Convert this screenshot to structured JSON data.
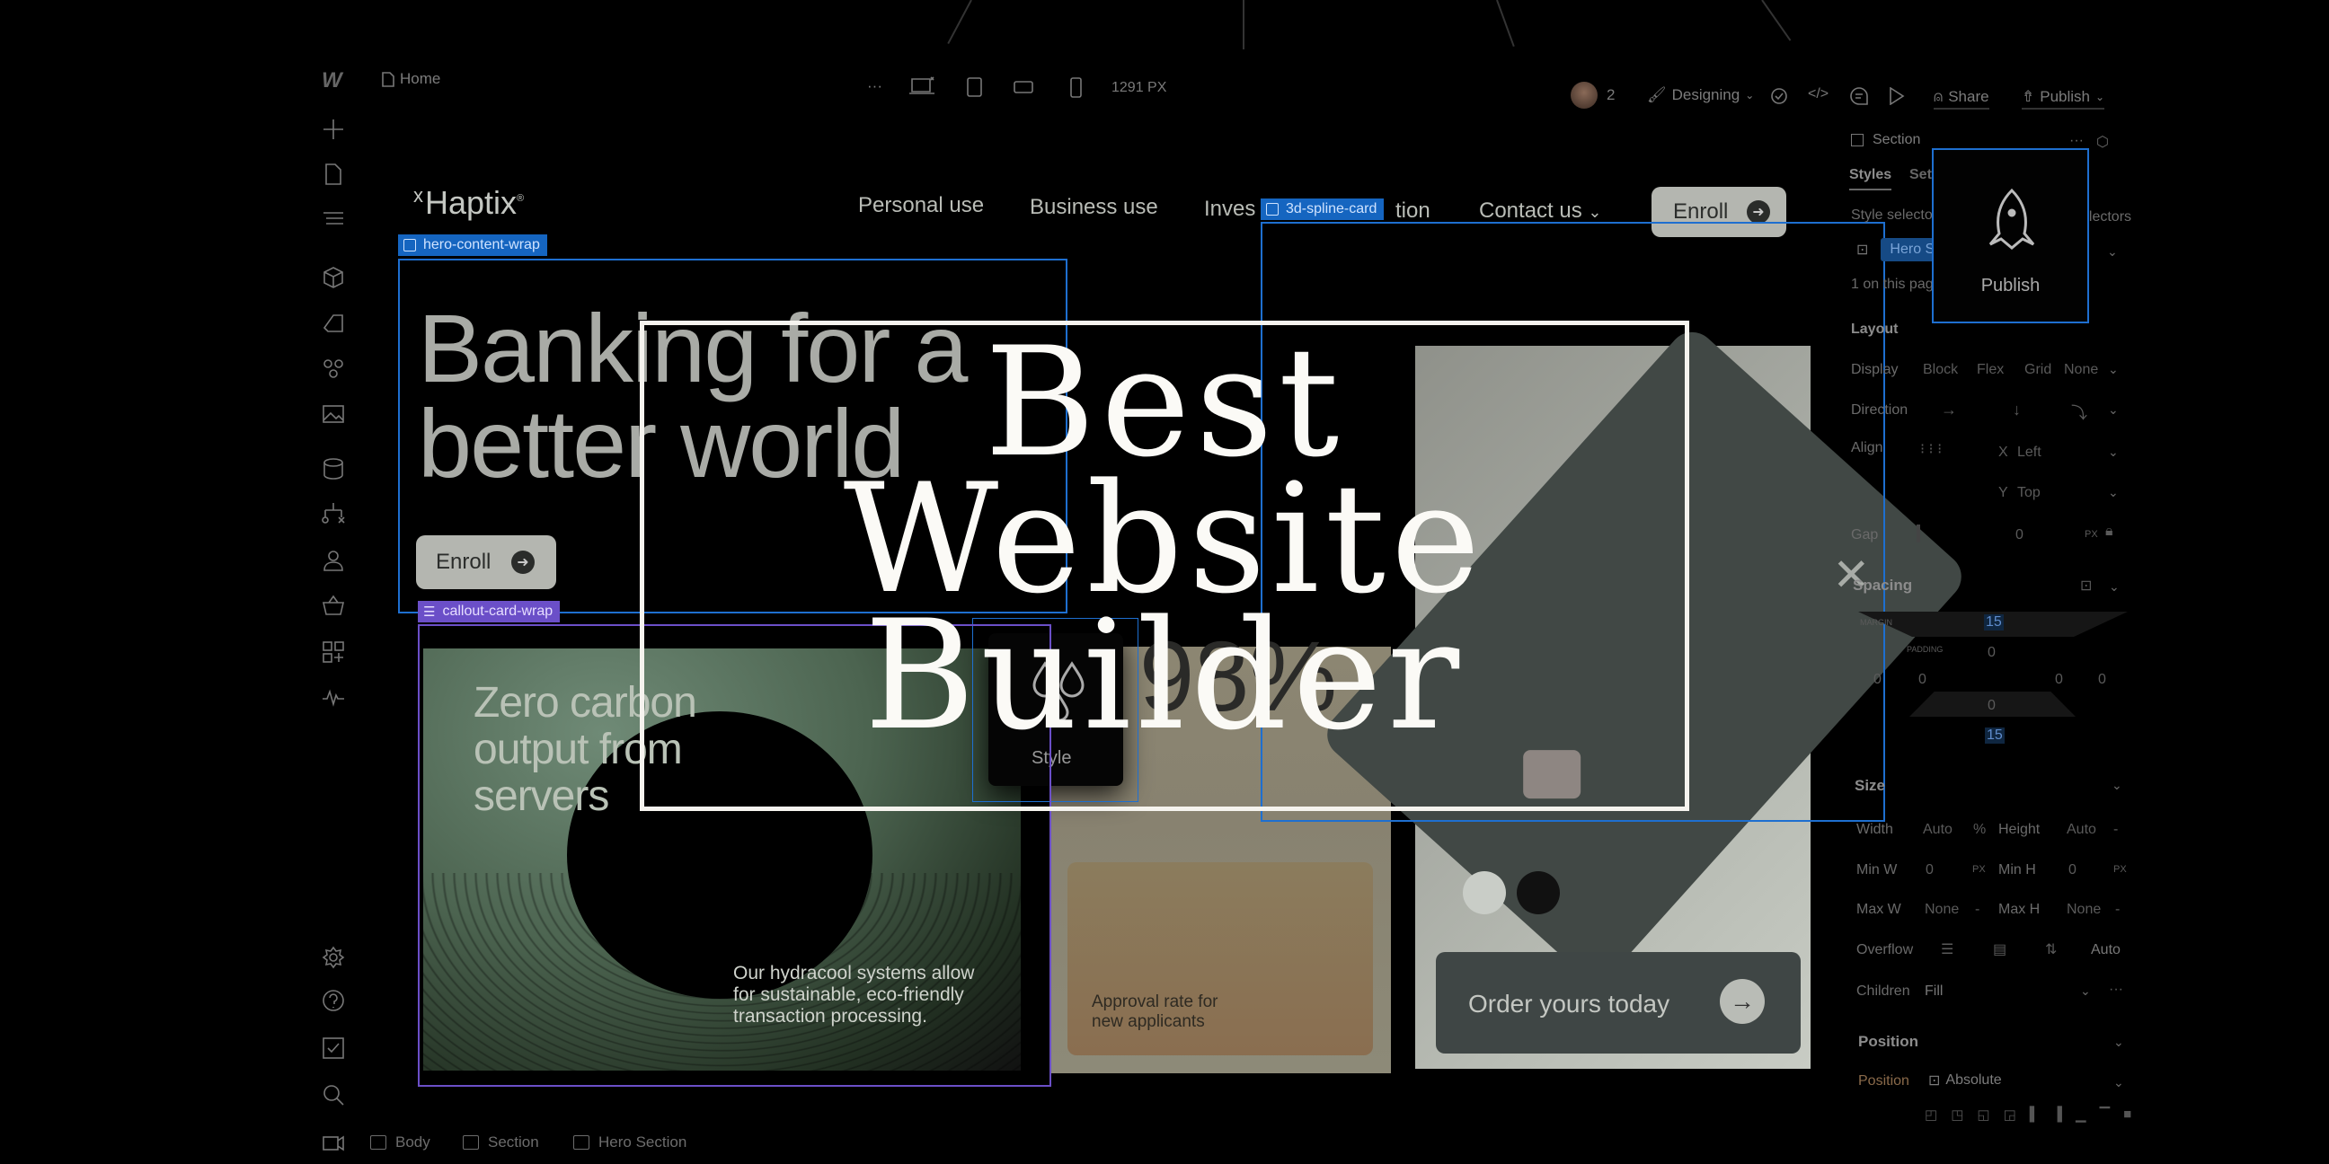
{
  "topbar": {
    "logo": "webflow-logo",
    "page_name": "Home",
    "more_label": "···",
    "viewport_width": "1291 PX",
    "collaborator_count": "2",
    "mode_label": "Designing",
    "share_label": "Share",
    "publish_label": "Publish"
  },
  "left_sidebar": {
    "top_icons": [
      "add-icon",
      "pages-icon",
      "navigator-icon",
      "components-icon",
      "variables-icon",
      "styles-icon",
      "assets-icon",
      "cms-icon",
      "logic-icon",
      "users-icon",
      "ecommerce-icon",
      "apps-icon",
      "audit-icon"
    ],
    "bottom_icons": [
      "settings-icon",
      "help-icon",
      "tasks-icon",
      "search-icon",
      "video-icon"
    ]
  },
  "site": {
    "brand": "Haptix",
    "brand_mark": "x",
    "nav": [
      "Personal use",
      "Business use",
      "Investigation",
      "Contact us"
    ],
    "nav_visible": [
      "Personal use",
      "Business use",
      "Inves",
      "tion",
      "Contact us"
    ],
    "nav_enroll": "Enroll",
    "hero_title_line1": "Banking for a",
    "hero_title_line2": "better world",
    "hero_enroll": "Enroll",
    "green_card_title": [
      "Zero carbon",
      "output from",
      "servers"
    ],
    "green_card_desc": [
      "Our hydracool systems allow",
      "for sustainable, eco-friendly",
      "transaction processing."
    ],
    "tan_card_stat": "98%",
    "tan_card_desc": [
      "Approval rate for",
      "new applicants"
    ],
    "style_popup_label": "Style",
    "order_button": "Order yours today",
    "color_swatches": [
      "#c9cdc7",
      "#111111"
    ]
  },
  "selection_labels": {
    "hero": "hero-content-wrap",
    "callout": "callout-card-wrap",
    "spline": "3d-spline-card"
  },
  "overlay": {
    "line1": "Best",
    "line2": "Website",
    "line3": "Builder"
  },
  "right_panel": {
    "element_type": "Section",
    "tabs": [
      "Styles",
      "Settings"
    ],
    "tab_visible": [
      "Styles",
      "Setti"
    ],
    "style_selector_label": "Style selector",
    "selectors_label": "selectors",
    "selected_class": "Hero Section",
    "selected_class_visible": "Hero Se",
    "usage_text": "1 on this page",
    "publish_popup": "Publish",
    "layout": {
      "heading": "Layout",
      "display_label": "Display",
      "display_options": [
        "Block",
        "Flex",
        "Grid",
        "None"
      ],
      "direction_label": "Direction",
      "align_label": "Align",
      "align_x": "Left",
      "align_y": "Top",
      "gap_label": "Gap",
      "gap_value": "0",
      "gap_unit": "PX"
    },
    "spacing": {
      "heading": "Spacing",
      "margin_label": "MARGIN",
      "padding_label": "PADDING",
      "margin_top": "15",
      "margin_bottom": "15",
      "margin_left": "0",
      "margin_right": "0",
      "padding_top": "0",
      "padding_bottom": "0",
      "padding_left": "0",
      "padding_right": "0"
    },
    "size": {
      "heading": "Size",
      "width_label": "Width",
      "width_value": "Auto",
      "width_unit": "%",
      "height_label": "Height",
      "height_value": "Auto",
      "height_unit": "-",
      "minw_label": "Min W",
      "minw_value": "0",
      "minw_unit": "PX",
      "minh_label": "Min H",
      "minh_value": "0",
      "minh_unit": "PX",
      "maxw_label": "Max W",
      "maxw_value": "None",
      "maxw_unit": "-",
      "maxh_label": "Max H",
      "maxh_value": "None",
      "maxh_unit": "-",
      "overflow_label": "Overflow",
      "overflow_value": "Auto",
      "children_label": "Children",
      "children_value": "Fill"
    },
    "position": {
      "heading": "Position",
      "label": "Position",
      "value": "Absolute"
    }
  },
  "breadcrumb": [
    "Body",
    "Section",
    "Hero Section"
  ],
  "colors": {
    "selection_blue": "#1e6fd0",
    "selection_purple": "#6b4fc8",
    "overlay_text": "#fbfaf6"
  }
}
